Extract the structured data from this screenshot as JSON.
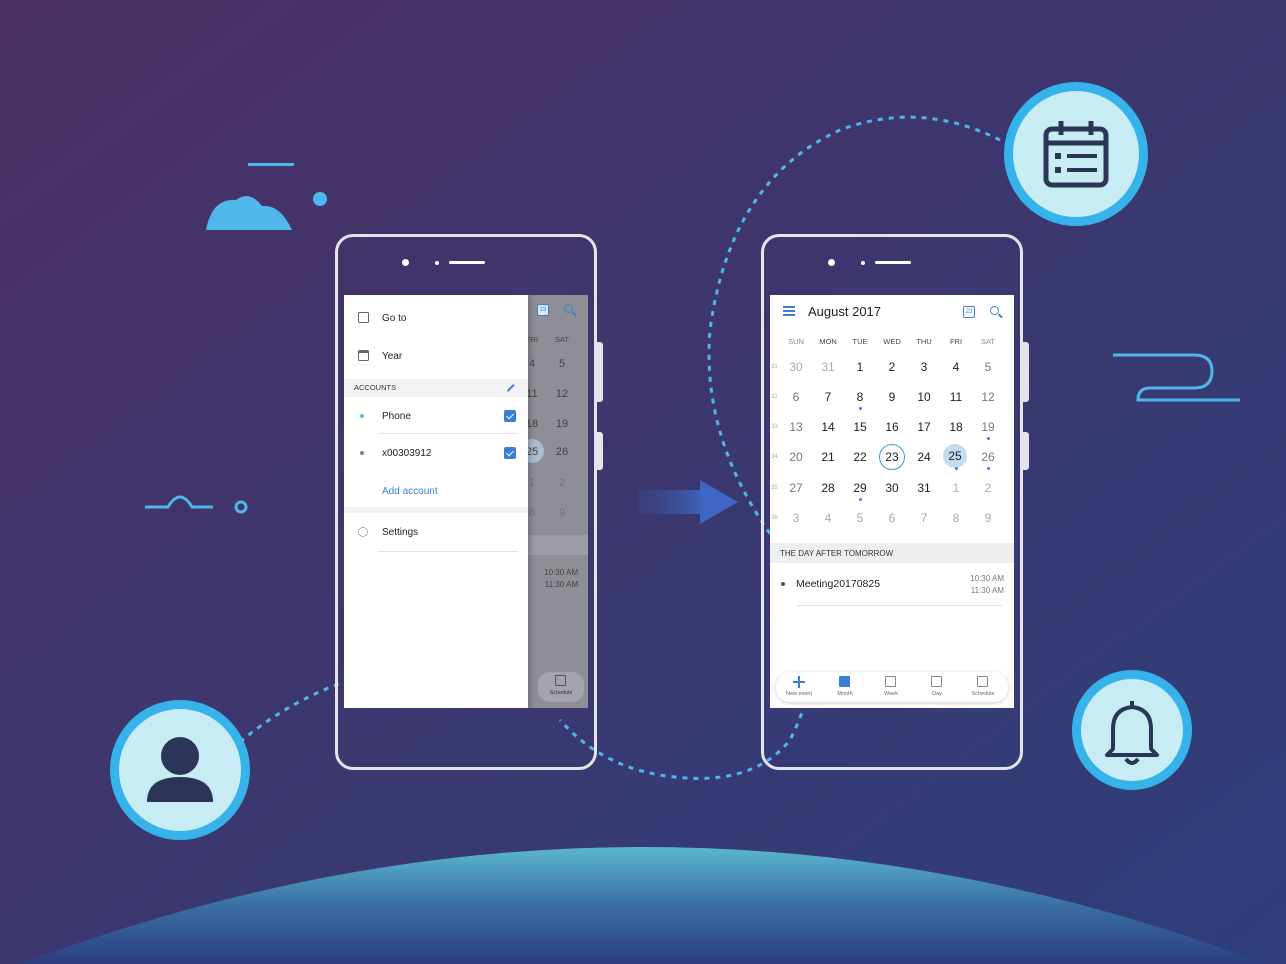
{
  "left_phone": {
    "drawer": {
      "goto_label": "Go to",
      "year_label": "Year",
      "accounts_header": "ACCOUNTS",
      "accounts": [
        {
          "name": "Phone",
          "dot_color": "#4fc3f7",
          "checked": true
        },
        {
          "name": "x00303912",
          "dot_color": "#7b8a6b",
          "checked": true
        }
      ],
      "add_account_label": "Add account",
      "settings_label": "Settings"
    },
    "behind": {
      "col_headers": [
        "FRI",
        "SAT"
      ],
      "rows": [
        [
          "4",
          "5"
        ],
        [
          "11",
          "12"
        ],
        [
          "18",
          "19"
        ],
        [
          "25",
          "26"
        ],
        [
          "1",
          "2"
        ],
        [
          "8",
          "9"
        ]
      ],
      "time_start": "10:30 AM",
      "time_end": "11:30 AM",
      "nav_label": "Schedule"
    }
  },
  "right_phone": {
    "header": {
      "title": "August 2017",
      "today_icon_text": "23"
    },
    "weekdays": [
      "SUN",
      "MON",
      "TUE",
      "WED",
      "THU",
      "FRI",
      "SAT"
    ],
    "week_numbers": [
      "31",
      "32",
      "33",
      "34",
      "35",
      "36"
    ],
    "weeks": [
      [
        "30",
        "31",
        "1",
        "2",
        "3",
        "4",
        "5"
      ],
      [
        "6",
        "7",
        "8",
        "9",
        "10",
        "11",
        "12"
      ],
      [
        "13",
        "14",
        "15",
        "16",
        "17",
        "18",
        "19"
      ],
      [
        "20",
        "21",
        "22",
        "23",
        "24",
        "25",
        "26"
      ],
      [
        "27",
        "28",
        "29",
        "30",
        "31",
        "1",
        "2"
      ],
      [
        "3",
        "4",
        "5",
        "6",
        "7",
        "8",
        "9"
      ]
    ],
    "today": "23",
    "selected": "25",
    "section_header": "THE DAY AFTER TOMORROW",
    "event": {
      "name": "Meeting20170825",
      "start": "10:30 AM",
      "end": "11:30 AM"
    },
    "bottom_nav": [
      {
        "label": "New event",
        "icon": "plus-icon"
      },
      {
        "label": "Month",
        "icon": "month-icon"
      },
      {
        "label": "Week",
        "icon": "week-icon"
      },
      {
        "label": "Day",
        "icon": "day-icon"
      },
      {
        "label": "Schedule",
        "icon": "schedule-icon"
      }
    ]
  },
  "decor_icons": [
    "cloud-icon",
    "calendar-list-icon",
    "person-icon",
    "bell-icon",
    "arrow-right-icon"
  ],
  "colors": {
    "bg_top": "#4a2f63",
    "bg_bottom": "#2f3f7a",
    "accent": "#3b7fd4",
    "ring": "#35b3ea",
    "circle_fill": "#c8ecf3",
    "icon_dark": "#2b3558"
  }
}
